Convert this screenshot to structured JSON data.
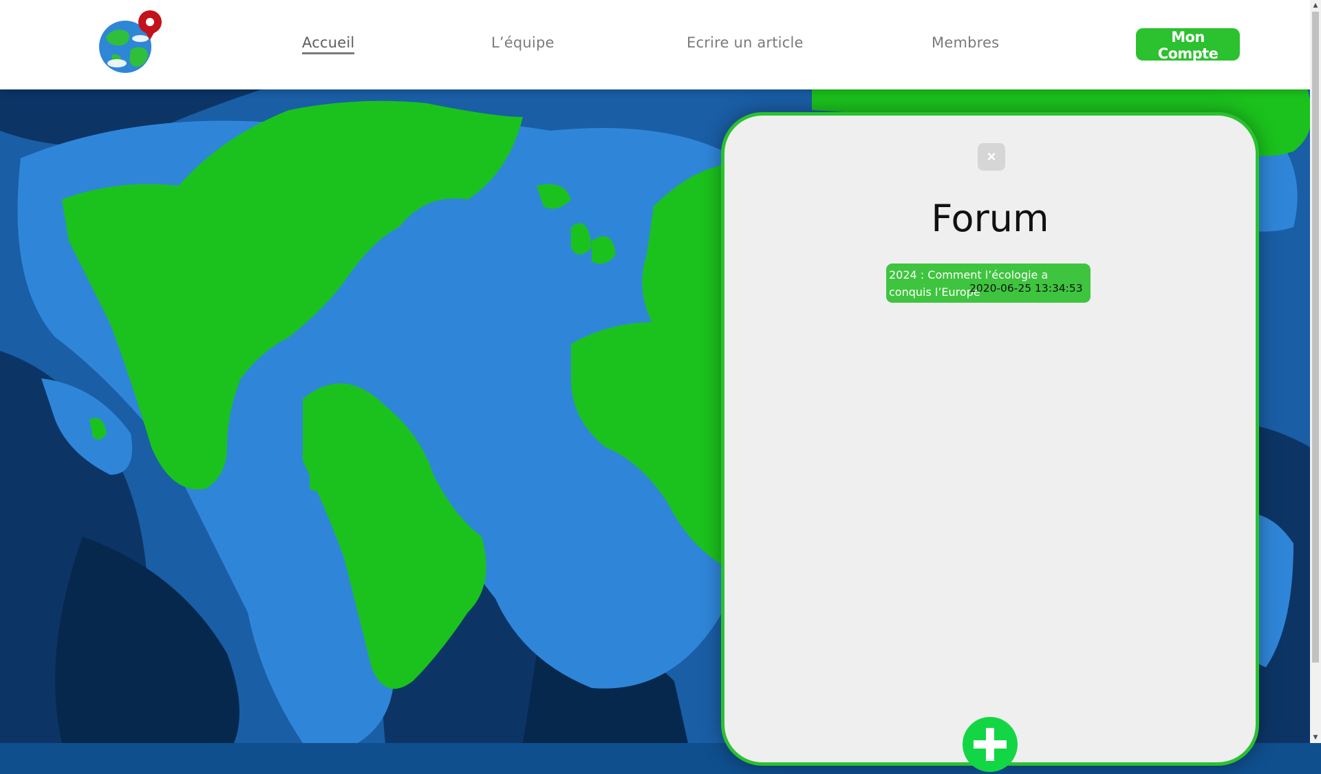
{
  "nav": {
    "links": [
      {
        "label": "Accueil",
        "active": true
      },
      {
        "label": "L’équipe"
      },
      {
        "label": "Ecrire un article"
      },
      {
        "label": "Membres"
      }
    ],
    "account_label": "Mon Compte"
  },
  "logo": {
    "icon": "globe-pin-icon"
  },
  "forum": {
    "title": "Forum",
    "close_label": "×",
    "topics": [
      {
        "title": "2024 : Comment l’écologie a conquis l’Europe",
        "date": "2020-06-25 13:34:53"
      }
    ],
    "add_icon": "plus-icon"
  },
  "colors": {
    "accent_green": "#2bc12f",
    "topic_green": "#3fc43f",
    "land_green": "#1bc21d",
    "ocean_light": "#2f86d9",
    "ocean_mid": "#1a5ea6",
    "ocean_dark": "#0c3566",
    "panel_bg": "#efefef"
  }
}
